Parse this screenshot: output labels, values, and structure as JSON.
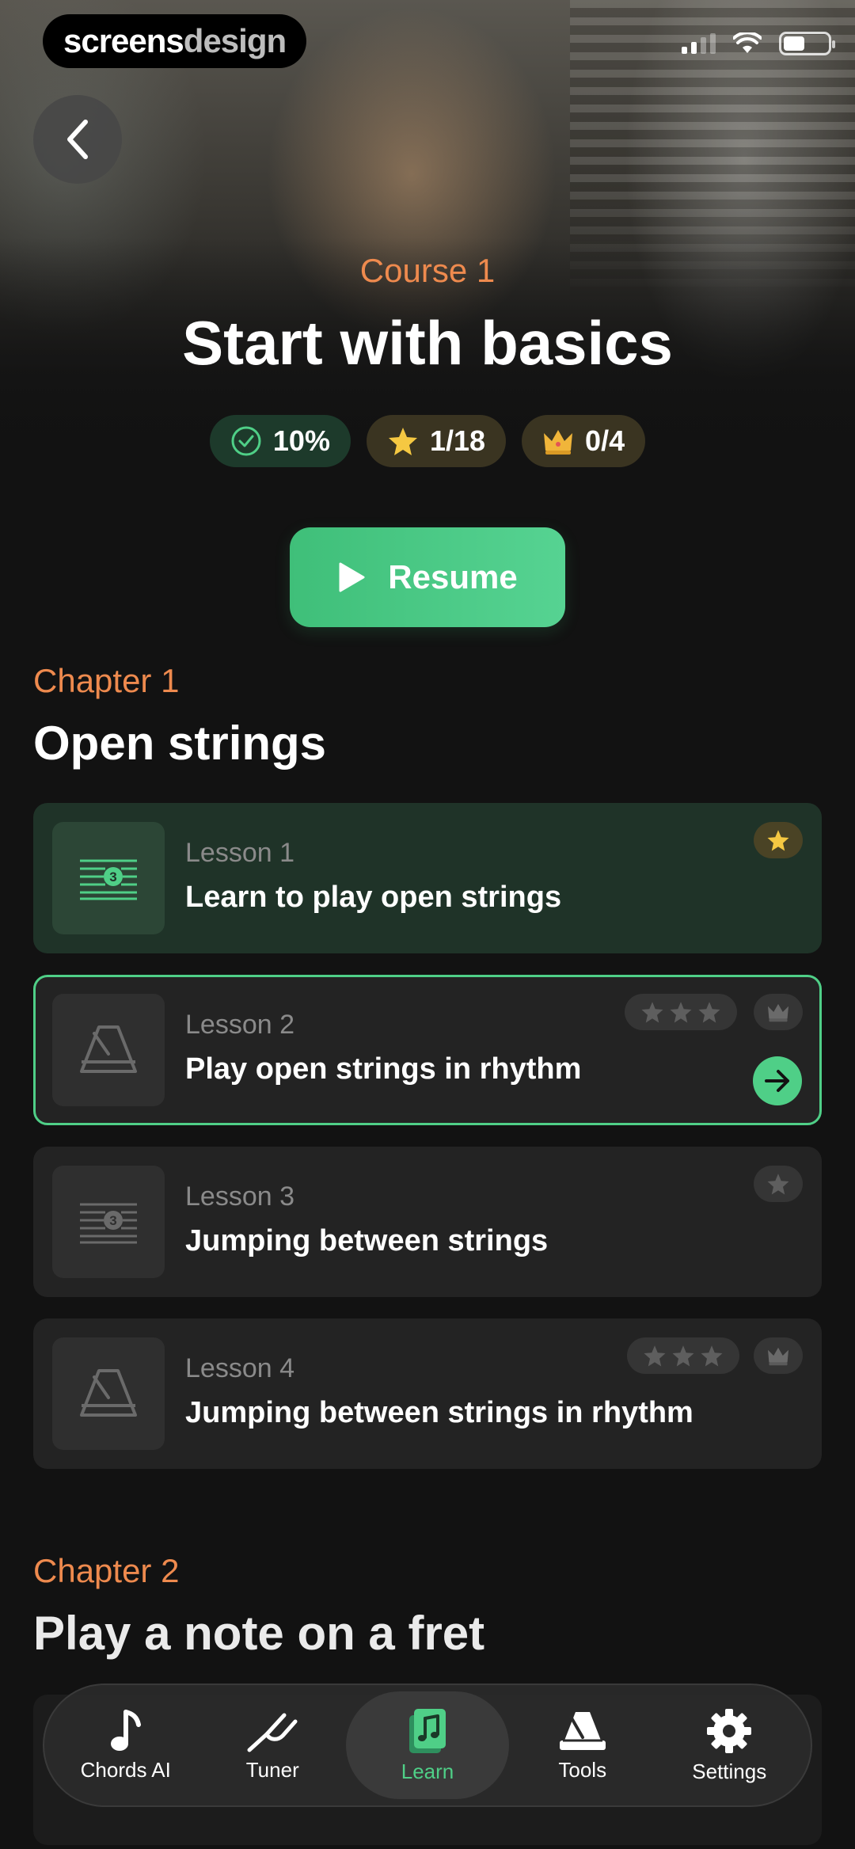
{
  "status_bar": {
    "brand_part1": "screens",
    "brand_part2": "design"
  },
  "course": {
    "label": "Course 1",
    "title": "Start with basics",
    "stats": {
      "progress": "10%",
      "stars": "1/18",
      "crowns": "0/4"
    },
    "resume_label": "Resume"
  },
  "chapters": [
    {
      "label": "Chapter 1",
      "title": "Open strings",
      "lessons": [
        {
          "number": "Lesson 1",
          "name": "Learn to play open strings",
          "state": "completed",
          "icon": "sheet-music-icon",
          "badges": "1 star earned"
        },
        {
          "number": "Lesson 2",
          "name": "Play open strings in rhythm",
          "state": "current",
          "icon": "metronome-icon",
          "badges": "3 stars + crown"
        },
        {
          "number": "Lesson 3",
          "name": "Jumping between strings",
          "state": "locked",
          "icon": "sheet-music-icon",
          "badges": "1 star"
        },
        {
          "number": "Lesson 4",
          "name": "Jumping between strings in rhythm",
          "state": "locked",
          "icon": "metronome-icon",
          "badges": "3 stars + crown"
        }
      ]
    },
    {
      "label": "Chapter 2",
      "title": "Play a note on a fret"
    }
  ],
  "tabbar": [
    {
      "label": "Chords AI",
      "icon": "music-note-icon",
      "active": false
    },
    {
      "label": "Tuner",
      "icon": "tuning-fork-icon",
      "active": false
    },
    {
      "label": "Learn",
      "icon": "music-book-icon",
      "active": true
    },
    {
      "label": "Tools",
      "icon": "metronome-icon",
      "active": false
    },
    {
      "label": "Settings",
      "icon": "gear-icon",
      "active": false
    }
  ],
  "colors": {
    "accent_orange": "#ee8a4e",
    "accent_green": "#4fcf87",
    "background": "#121212",
    "star_gold": "#f5c842"
  }
}
